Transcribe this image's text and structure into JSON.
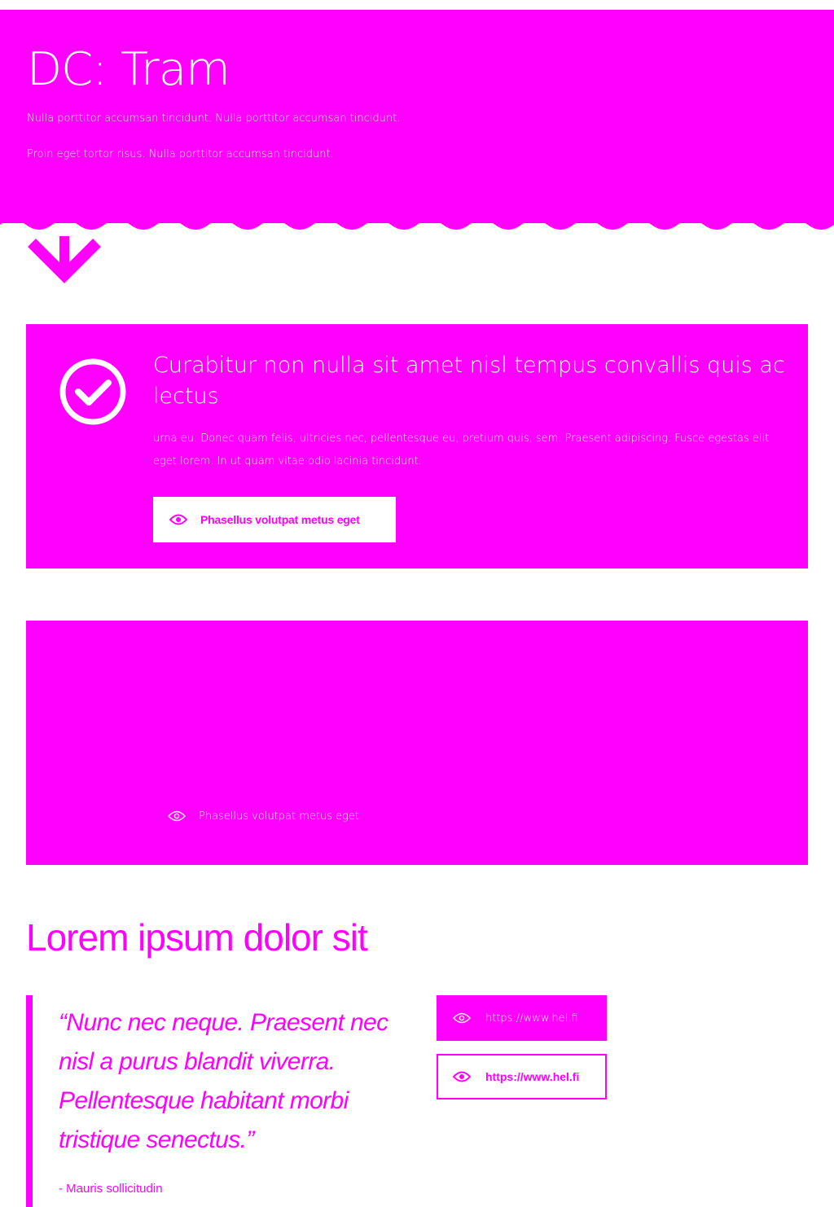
{
  "colors": {
    "brand": "#ff00ff",
    "background": "#ffffff",
    "on_brand": "#ffffff"
  },
  "hero": {
    "title": "DC: Tram",
    "paragraphs": [
      "Nulla porttitor accumsan tincidunt. Nulla porttitor accumsan tincidunt.",
      "Proin eget tortor risus. Nulla porttitor accumsan tincidunt."
    ]
  },
  "card1": {
    "title": "Curabitur non nulla sit amet nisl tempus convallis quis ac lectus",
    "text": "urna eu. Donec quam felis, ultricies nec, pellentesque eu, pretium quis, sem. Praesent adipiscing. Fusce egestas elit eget lorem. In ut quam vitae odio lacinia tincidunt.",
    "button_label": "Phasellus volutpat metus eget"
  },
  "card2": {
    "link_label": "Phasellus volutpat metus eget"
  },
  "section": {
    "title": "Lorem ipsum dolor sit"
  },
  "quote": {
    "text": "“Nunc nec neque. Praesent nec nisl a purus blandit viverra. Pellentesque habitant morbi tristique senectus.”",
    "author": "- Mauris sollicitudin"
  },
  "links": {
    "filled_label": "https://www.hel.fi",
    "outline_label": "https://www.hel.fi"
  },
  "icons": {
    "arrow": "arrow-down-icon",
    "check": "check-circle-icon",
    "eye": "eye-icon"
  }
}
